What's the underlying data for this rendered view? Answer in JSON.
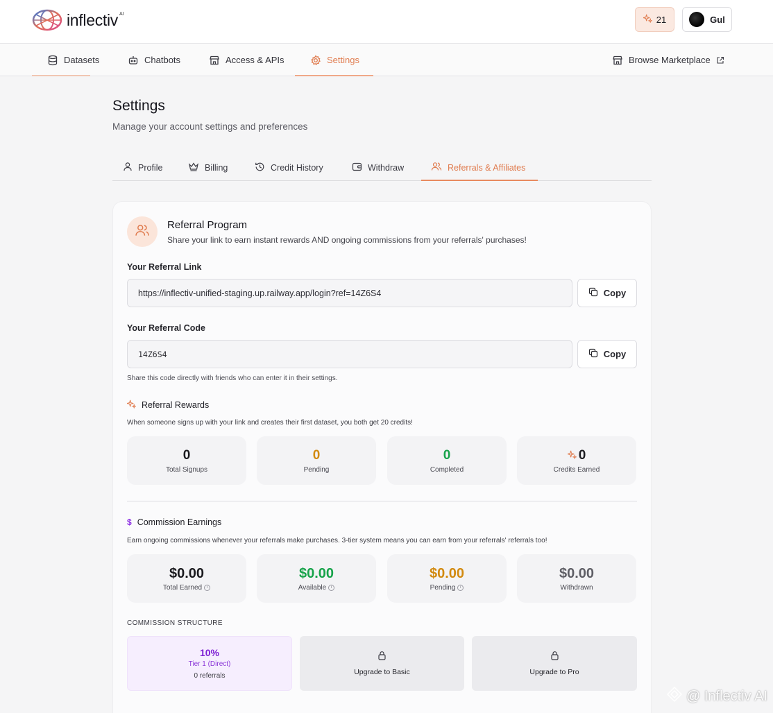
{
  "header": {
    "logo_text": "inflectiv",
    "logo_sup": "AI",
    "credits": "21",
    "user_name": "Gul"
  },
  "nav": {
    "items": [
      {
        "label": "Datasets",
        "icon": "database-icon"
      },
      {
        "label": "Chatbots",
        "icon": "bot-icon"
      },
      {
        "label": "Access & APIs",
        "icon": "store-icon"
      },
      {
        "label": "Settings",
        "icon": "gear-icon"
      }
    ],
    "active": "Settings",
    "browse_label": "Browse Marketplace"
  },
  "page": {
    "title": "Settings",
    "subtitle": "Manage your account settings and preferences"
  },
  "tabs": [
    {
      "label": "Profile",
      "icon": "user-icon"
    },
    {
      "label": "Billing",
      "icon": "crown-icon"
    },
    {
      "label": "Credit History",
      "icon": "history-icon"
    },
    {
      "label": "Withdraw",
      "icon": "wallet-icon"
    },
    {
      "label": "Referrals & Affiliates",
      "icon": "users-icon"
    }
  ],
  "active_tab": "Referrals & Affiliates",
  "referral": {
    "title": "Referral Program",
    "subtitle": "Share your link to earn instant rewards AND ongoing commissions from your referrals' purchases!",
    "link_label": "Your Referral Link",
    "link_value": "https://inflectiv-unified-staging.up.railway.app/login?ref=14Z6S4",
    "code_label": "Your Referral Code",
    "code_value": "14Z6S4",
    "copy_label": "Copy",
    "code_hint": "Share this code directly with friends who can enter it in their settings."
  },
  "rewards": {
    "title": "Referral Rewards",
    "desc": "When someone signs up with your link and creates their first dataset, you both get 20 credits!",
    "stats": [
      {
        "value": "0",
        "label": "Total Signups",
        "color": "#16161d"
      },
      {
        "value": "0",
        "label": "Pending",
        "color": "#d28a10"
      },
      {
        "value": "0",
        "label": "Completed",
        "color": "#17a34a"
      },
      {
        "value": "0",
        "label": "Credits Earned",
        "color": "#16161d"
      }
    ]
  },
  "commission": {
    "title": "Commission Earnings",
    "icon": "$",
    "desc": "Earn ongoing commissions whenever your referrals make purchases. 3-tier system means you can earn from your referrals' referrals too!",
    "stats": [
      {
        "value": "$0.00",
        "label": "Total Earned",
        "color": "#16161d",
        "info": true
      },
      {
        "value": "$0.00",
        "label": "Available",
        "color": "#17a34a",
        "info": true
      },
      {
        "value": "$0.00",
        "label": "Pending",
        "color": "#d28a10",
        "info": true
      },
      {
        "value": "$0.00",
        "label": "Withdrawn",
        "color": "#5f5f66",
        "info": false
      }
    ],
    "structure_label": "COMMISSION STRUCTURE",
    "tiers": [
      {
        "pct": "10%",
        "name": "Tier 1 (Direct)",
        "referrals": "0 referrals"
      },
      {
        "locked_label": "Upgrade to Basic"
      },
      {
        "locked_label": "Upgrade to Pro"
      }
    ]
  },
  "watermark": "@ Inflectiv AI",
  "colors": {
    "accent": "#e07c4f",
    "purple": "#7d1fd4",
    "green": "#17a34a",
    "amber": "#d28a10"
  }
}
